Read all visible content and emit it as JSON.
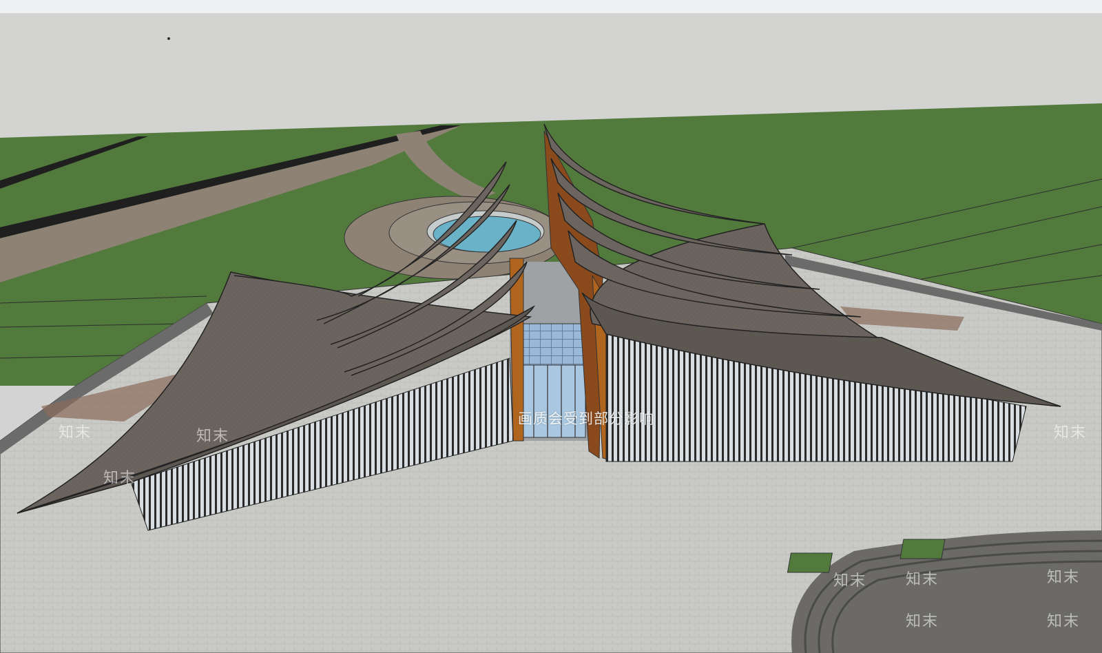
{
  "window": {
    "title": ""
  },
  "scene": {
    "description_label": "",
    "colors": {
      "sky": "#d3d3d1",
      "grass": "#527a3c",
      "paving": "#c9c9c6",
      "roof": "#6b6560",
      "wall_wood": "#8a4a1c",
      "glass": "#a9c7e0",
      "water": "#6ab2c8",
      "path": "#8e8275"
    }
  },
  "overlay": {
    "quality_banner": "画质会受到部分影响",
    "watermarks": [
      "知末",
      "知末",
      "知末",
      "知末",
      "知末",
      "知末",
      "知末",
      "知末",
      "知末"
    ]
  }
}
